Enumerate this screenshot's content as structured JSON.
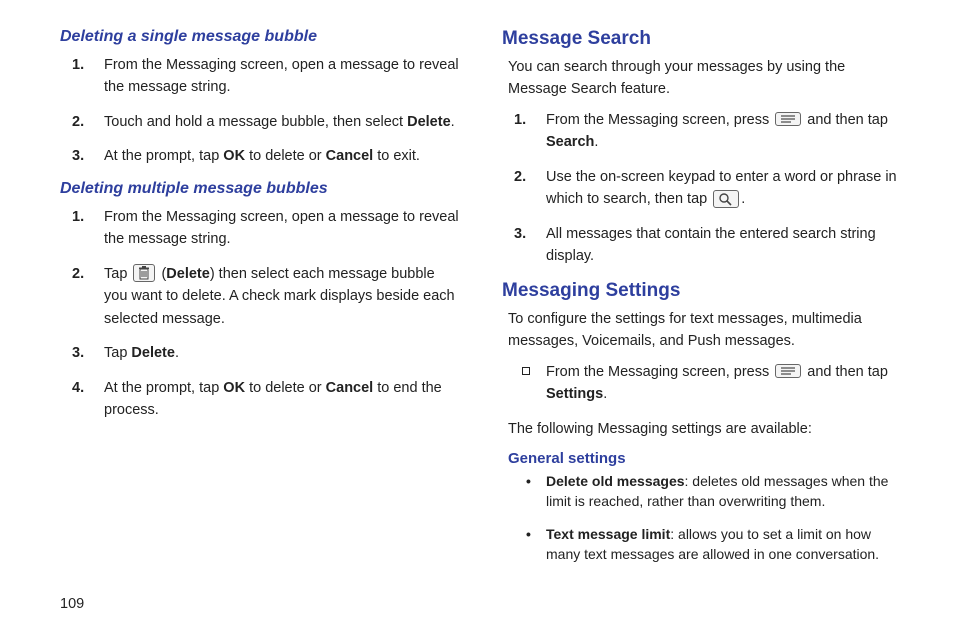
{
  "page_number": "109",
  "col1": {
    "section1": {
      "heading": "Deleting a single message bubble",
      "items": [
        {
          "n": "1.",
          "text_pre": "From the Messaging screen, open a message to reveal the message string."
        },
        {
          "n": "2.",
          "text_pre": "Touch and hold a message bubble, then select ",
          "bold1": "Delete",
          "text_post": "."
        },
        {
          "n": "3.",
          "text_pre": "At the prompt, tap ",
          "bold1": "OK",
          "text_mid": " to delete or ",
          "bold2": "Cancel",
          "text_post": " to exit."
        }
      ]
    },
    "section2": {
      "heading": "Deleting multiple message bubbles",
      "items": [
        {
          "n": "1.",
          "text_pre": "From the Messaging screen, open a message to reveal the message string."
        },
        {
          "n": "2.",
          "text_pre": "Tap ",
          "icon": "trash",
          "text_mid": " (",
          "bold1": "Delete",
          "text_post": ") then select each message bubble you want to delete. A check mark displays beside each selected message."
        },
        {
          "n": "3.",
          "text_pre": "Tap ",
          "bold1": "Delete",
          "text_post": "."
        },
        {
          "n": "4.",
          "text_pre": "At the prompt, tap ",
          "bold1": "OK",
          "text_mid": " to delete or ",
          "bold2": "Cancel",
          "text_post": " to end the process."
        }
      ]
    }
  },
  "col2": {
    "search": {
      "heading": "Message Search",
      "intro": "You can search through your messages by using the Message Search feature.",
      "items": [
        {
          "n": "1.",
          "text_pre": "From the Messaging screen, press ",
          "icon": "menu",
          "text_mid": " and then tap ",
          "bold1": "Search",
          "text_post": "."
        },
        {
          "n": "2.",
          "text_pre": "Use the on-screen keypad to enter a word or phrase in which to search, then tap ",
          "icon": "search",
          "text_post": "."
        },
        {
          "n": "3.",
          "text_pre": "All messages that contain the entered search string display."
        }
      ]
    },
    "settings": {
      "heading": "Messaging Settings",
      "intro": "To configure the settings for text messages, multimedia messages, Voicemails, and Push messages.",
      "square_item": {
        "text_pre": "From the Messaging screen, press ",
        "icon": "menu",
        "text_mid": " and then tap ",
        "bold1": "Settings",
        "text_post": "."
      },
      "intro2": "The following Messaging settings are available:",
      "general": {
        "heading": "General settings",
        "bullets": [
          {
            "bold": "Delete old messages",
            "rest": ": deletes old messages when the limit is reached, rather than overwriting them."
          },
          {
            "bold": "Text message limit",
            "rest": ": allows you to set a limit on how many text messages are allowed in one conversation."
          }
        ]
      }
    }
  }
}
